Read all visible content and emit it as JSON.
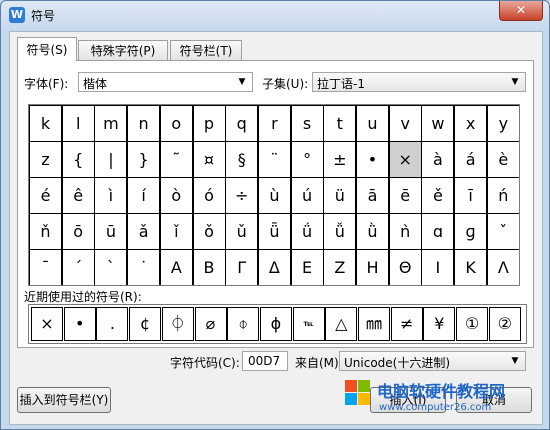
{
  "window": {
    "title": "符号",
    "app_icon_letter": "W",
    "close_glyph": "✕"
  },
  "tabs": [
    {
      "label": "符号(S)",
      "active": true
    },
    {
      "label": "特殊字符(P)",
      "active": false
    },
    {
      "label": "符号栏(T)",
      "active": false
    }
  ],
  "font": {
    "label": "字体(F):",
    "value": "楷体"
  },
  "subset": {
    "label": "子集(U):",
    "value": "拉丁语-1"
  },
  "symbol_grid": [
    [
      "k",
      "l",
      "m",
      "n",
      "o",
      "p",
      "q",
      "r",
      "s",
      "t",
      "u",
      "v",
      "w",
      "x",
      "y"
    ],
    [
      "z",
      "{",
      "|",
      "}",
      "˜",
      "¤",
      "§",
      "¨",
      "°",
      "±",
      "•",
      "×",
      "à",
      "á",
      "è"
    ],
    [
      "é",
      "ê",
      "ì",
      "í",
      "ò",
      "ó",
      "÷",
      "ù",
      "ú",
      "ü",
      "ā",
      "ē",
      "ě",
      "ī",
      "ń"
    ],
    [
      "ň",
      "ō",
      "ū",
      "ǎ",
      "ǐ",
      "ǒ",
      "ǔ",
      "ǖ",
      "ǘ",
      "ǚ",
      "ǜ",
      "ǹ",
      "ɑ",
      "ɡ",
      "ˇ"
    ],
    [
      "ˉ",
      "ˊ",
      "ˋ",
      "˙",
      "Α",
      "Β",
      "Γ",
      "Δ",
      "Ε",
      "Ζ",
      "Η",
      "Θ",
      "Ι",
      "Κ",
      "Λ"
    ]
  ],
  "selected": {
    "row": 1,
    "col": 11
  },
  "recent": {
    "label": "近期使用过的符号(R):",
    "symbols": [
      "×",
      "•",
      ".",
      "¢",
      "⏀",
      "⌀",
      "⌽",
      "ϕ",
      "℡",
      "△",
      "㎜",
      "≠",
      "¥",
      "①",
      "②"
    ]
  },
  "char_code": {
    "label": "字符代码(C):",
    "value": "00D7"
  },
  "from": {
    "label": "来自(M)",
    "value": "Unicode(十六进制)"
  },
  "buttons": {
    "insert_to_bar": "插入到符号栏(Y)",
    "insert": "插入(I)",
    "cancel": "取消"
  },
  "watermark": {
    "text": "电脑软硬件教程网",
    "url": "www.computer26.com"
  },
  "colors": {
    "titlebar": "#c6d8ec",
    "close": "#c7432b",
    "selected_cell": "#cfcfcf",
    "watermark": "#1f67c7"
  }
}
